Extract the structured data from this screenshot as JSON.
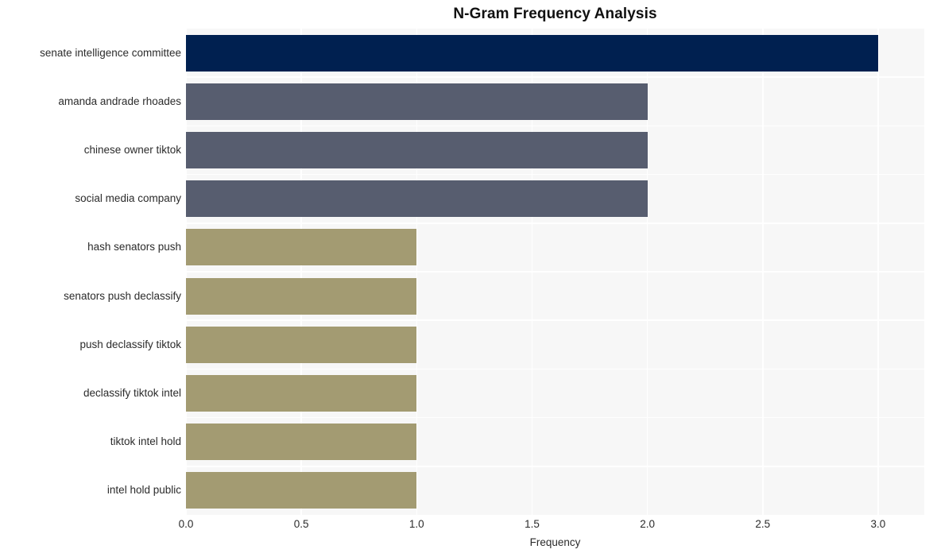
{
  "chart_data": {
    "type": "bar",
    "orientation": "horizontal",
    "title": "N-Gram Frequency Analysis",
    "xlabel": "Frequency",
    "ylabel": "",
    "xlim": [
      0,
      3.2
    ],
    "xticks": [
      "0.0",
      "0.5",
      "1.0",
      "1.5",
      "2.0",
      "2.5",
      "3.0"
    ],
    "xtick_values": [
      0.0,
      0.5,
      1.0,
      1.5,
      2.0,
      2.5,
      3.0
    ],
    "grid": true,
    "legend": "none",
    "categories": [
      "senate intelligence committee",
      "amanda andrade rhoades",
      "chinese owner tiktok",
      "social media company",
      "hash senators push",
      "senators push declassify",
      "push declassify tiktok",
      "declassify tiktok intel",
      "tiktok intel hold",
      "intel hold public"
    ],
    "values": [
      3,
      2,
      2,
      2,
      1,
      1,
      1,
      1,
      1,
      1
    ],
    "bar_colors": [
      "#002050",
      "#575d6f",
      "#575d6f",
      "#575d6f",
      "#a39b72",
      "#a39b72",
      "#a39b72",
      "#a39b72",
      "#a39b72",
      "#a39b72"
    ],
    "plot_background": "#f7f7f7",
    "grid_color": "#ffffff",
    "figure_background": "#ffffff",
    "text_color": "#2b2b2b"
  }
}
